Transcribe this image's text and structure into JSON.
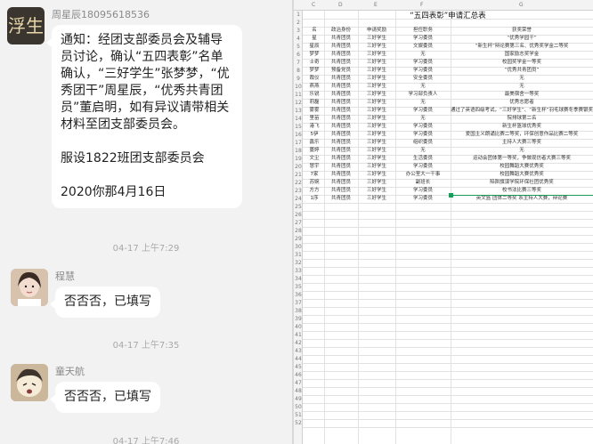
{
  "chat": {
    "messages": [
      {
        "sender": "周星辰18095618536",
        "avatar_text": "浮生",
        "paragraph1": "通知：经团支部委员会及辅导员讨论，确认“五四表彰”名单确认，“三好学生”张梦梦，“优秀团干”周星辰，“优秀共青团员”董启明，如有异议请带相关材料至团支部委员会。",
        "paragraph2": "服设1822班团支部委员会",
        "paragraph3": "2020你那4月16日"
      },
      {
        "sender": "程慧",
        "text": "否否否，已填写"
      },
      {
        "sender": "童天航",
        "text": "否否否，已填写"
      }
    ],
    "timestamps": [
      "04-17 上午7:29",
      "04-17 上午7:35",
      "04-17 上午7:46"
    ]
  },
  "sheet": {
    "title": "“五四表彰”申请汇总表",
    "columns": [
      "C",
      "D",
      "E",
      "F",
      "G"
    ],
    "rows": [
      {
        "n": "1",
        "c": "",
        "d": "",
        "e": "",
        "f": "",
        "g": ""
      },
      {
        "n": "2",
        "c": "",
        "d": "",
        "e": "",
        "f": "",
        "g": ""
      },
      {
        "n": "3",
        "c": "名",
        "d": "政治身份",
        "e": "申请奖励",
        "f": "担任职务",
        "g": "获奖荣誉"
      },
      {
        "n": "4",
        "c": "星",
        "d": "共青团员",
        "e": "三好学生",
        "f": "学习委员",
        "g": "“优秀学园干”"
      },
      {
        "n": "5",
        "c": "星辰",
        "d": "共青团员",
        "e": "三好学生",
        "f": "文娱委员",
        "g": "“新生杯”辩论赛第三名、优秀奖学金二等奖"
      },
      {
        "n": "6",
        "c": "梦梦",
        "d": "共青团员",
        "e": "三好学生",
        "f": "无",
        "g": "国家励志奖学金"
      },
      {
        "n": "7",
        "c": "士奇",
        "d": "共青团员",
        "e": "三好学生",
        "f": "学习委员",
        "g": "校园奖学金一等奖"
      },
      {
        "n": "8",
        "c": "梦梦",
        "d": "预备党员",
        "e": "三好学生",
        "f": "学习委员",
        "g": "“优秀共青团员”"
      },
      {
        "n": "9",
        "c": "裁仪",
        "d": "共青团员",
        "e": "三好学生",
        "f": "安全委员",
        "g": "无"
      },
      {
        "n": "10",
        "c": "燕燕",
        "d": "共青团员",
        "e": "三好学生",
        "f": "无",
        "g": "无"
      },
      {
        "n": "11",
        "c": "乐锐",
        "d": "共青团员",
        "e": "三好学生",
        "f": "学习部负责人",
        "g": "最美宿舍一等奖"
      },
      {
        "n": "12",
        "c": "莉磊",
        "d": "共青团员",
        "e": "三好学生",
        "f": "无",
        "g": "优秀志愿者"
      },
      {
        "n": "13",
        "c": "雾雾",
        "d": "共青团员",
        "e": "三好学生",
        "f": "学习委员",
        "g": "通过了英语四级考试，“三好学生”、“新生杯”羽毛球赛冬季赛银奖"
      },
      {
        "n": "14",
        "c": "里苗",
        "d": "共青团员",
        "e": "三好学生",
        "f": "无",
        "g": "院排球第二名"
      },
      {
        "n": "15",
        "c": "港飞",
        "d": "共青团员",
        "e": "三好学生",
        "f": "学习委员",
        "g": "新生杯篮球优秀奖"
      },
      {
        "n": "16",
        "c": "5伊",
        "d": "共青团员",
        "e": "三好学生",
        "f": "学习委员",
        "g": "爱国主义朗诵比赛二等奖，环保创意作品比赛二等奖"
      },
      {
        "n": "17",
        "c": "鑫乐",
        "d": "共青团员",
        "e": "三好学生",
        "f": "组织委员",
        "g": "主持人大赛三等奖"
      },
      {
        "n": "18",
        "c": "蔓婷",
        "d": "共青团员",
        "e": "三好学生",
        "f": "无",
        "g": "无"
      },
      {
        "n": "19",
        "c": "文尘",
        "d": "共青团员",
        "e": "三好学生",
        "f": "生活委员",
        "g": "运动会团体第一等奖，争做现仿者大赛三等奖"
      },
      {
        "n": "20",
        "c": "慧宇",
        "d": "共青团员",
        "e": "三好学生",
        "f": "学习委员",
        "g": "校园舞蹈大赛优秀奖"
      },
      {
        "n": "21",
        "c": "7家",
        "d": "共青团员",
        "e": "三好学生",
        "f": "办公室大一干事",
        "g": "校园舞蹈大赛优秀奖"
      },
      {
        "n": "22",
        "c": "苏婉",
        "d": "共青团员",
        "e": "三好学生",
        "f": "副班长",
        "g": "陷阱旗谋学院环保社团优秀奖"
      },
      {
        "n": "23",
        "c": "方方",
        "d": "共青团员",
        "e": "三好学生",
        "f": "学习委员",
        "g": "校书法比赛三等奖"
      },
      {
        "n": "24",
        "c": "1序",
        "d": "共青团员",
        "e": "三好学生",
        "f": "学习委员",
        "g": "英文篮 团体二等奖 系主持人大赛，辩论赛"
      },
      {
        "n": "25",
        "c": "",
        "d": "",
        "e": "",
        "f": "",
        "g": ""
      },
      {
        "n": "26",
        "c": "",
        "d": "",
        "e": "",
        "f": "",
        "g": ""
      },
      {
        "n": "27",
        "c": "",
        "d": "",
        "e": "",
        "f": "",
        "g": ""
      },
      {
        "n": "28",
        "c": "",
        "d": "",
        "e": "",
        "f": "",
        "g": ""
      },
      {
        "n": "29",
        "c": "",
        "d": "",
        "e": "",
        "f": "",
        "g": ""
      },
      {
        "n": "30",
        "c": "",
        "d": "",
        "e": "",
        "f": "",
        "g": ""
      },
      {
        "n": "31",
        "c": "",
        "d": "",
        "e": "",
        "f": "",
        "g": ""
      },
      {
        "n": "32",
        "c": "",
        "d": "",
        "e": "",
        "f": "",
        "g": ""
      },
      {
        "n": "33",
        "c": "",
        "d": "",
        "e": "",
        "f": "",
        "g": ""
      },
      {
        "n": "34",
        "c": "",
        "d": "",
        "e": "",
        "f": "",
        "g": ""
      },
      {
        "n": "35",
        "c": "",
        "d": "",
        "e": "",
        "f": "",
        "g": ""
      },
      {
        "n": "36",
        "c": "",
        "d": "",
        "e": "",
        "f": "",
        "g": ""
      },
      {
        "n": "37",
        "c": "",
        "d": "",
        "e": "",
        "f": "",
        "g": ""
      },
      {
        "n": "38",
        "c": "",
        "d": "",
        "e": "",
        "f": "",
        "g": ""
      },
      {
        "n": "39",
        "c": "",
        "d": "",
        "e": "",
        "f": "",
        "g": ""
      },
      {
        "n": "40",
        "c": "",
        "d": "",
        "e": "",
        "f": "",
        "g": ""
      },
      {
        "n": "41",
        "c": "",
        "d": "",
        "e": "",
        "f": "",
        "g": ""
      },
      {
        "n": "42",
        "c": "",
        "d": "",
        "e": "",
        "f": "",
        "g": ""
      },
      {
        "n": "43",
        "c": "",
        "d": "",
        "e": "",
        "f": "",
        "g": ""
      },
      {
        "n": "44",
        "c": "",
        "d": "",
        "e": "",
        "f": "",
        "g": ""
      },
      {
        "n": "45",
        "c": "",
        "d": "",
        "e": "",
        "f": "",
        "g": ""
      },
      {
        "n": "46",
        "c": "",
        "d": "",
        "e": "",
        "f": "",
        "g": ""
      },
      {
        "n": "47",
        "c": "",
        "d": "",
        "e": "",
        "f": "",
        "g": ""
      },
      {
        "n": "48",
        "c": "",
        "d": "",
        "e": "",
        "f": "",
        "g": ""
      },
      {
        "n": "49",
        "c": "",
        "d": "",
        "e": "",
        "f": "",
        "g": ""
      },
      {
        "n": "50",
        "c": "",
        "d": "",
        "e": "",
        "f": "",
        "g": ""
      },
      {
        "n": "51",
        "c": "",
        "d": "",
        "e": "",
        "f": "",
        "g": ""
      },
      {
        "n": "52",
        "c": "",
        "d": "",
        "e": "",
        "f": "",
        "g": ""
      }
    ]
  }
}
